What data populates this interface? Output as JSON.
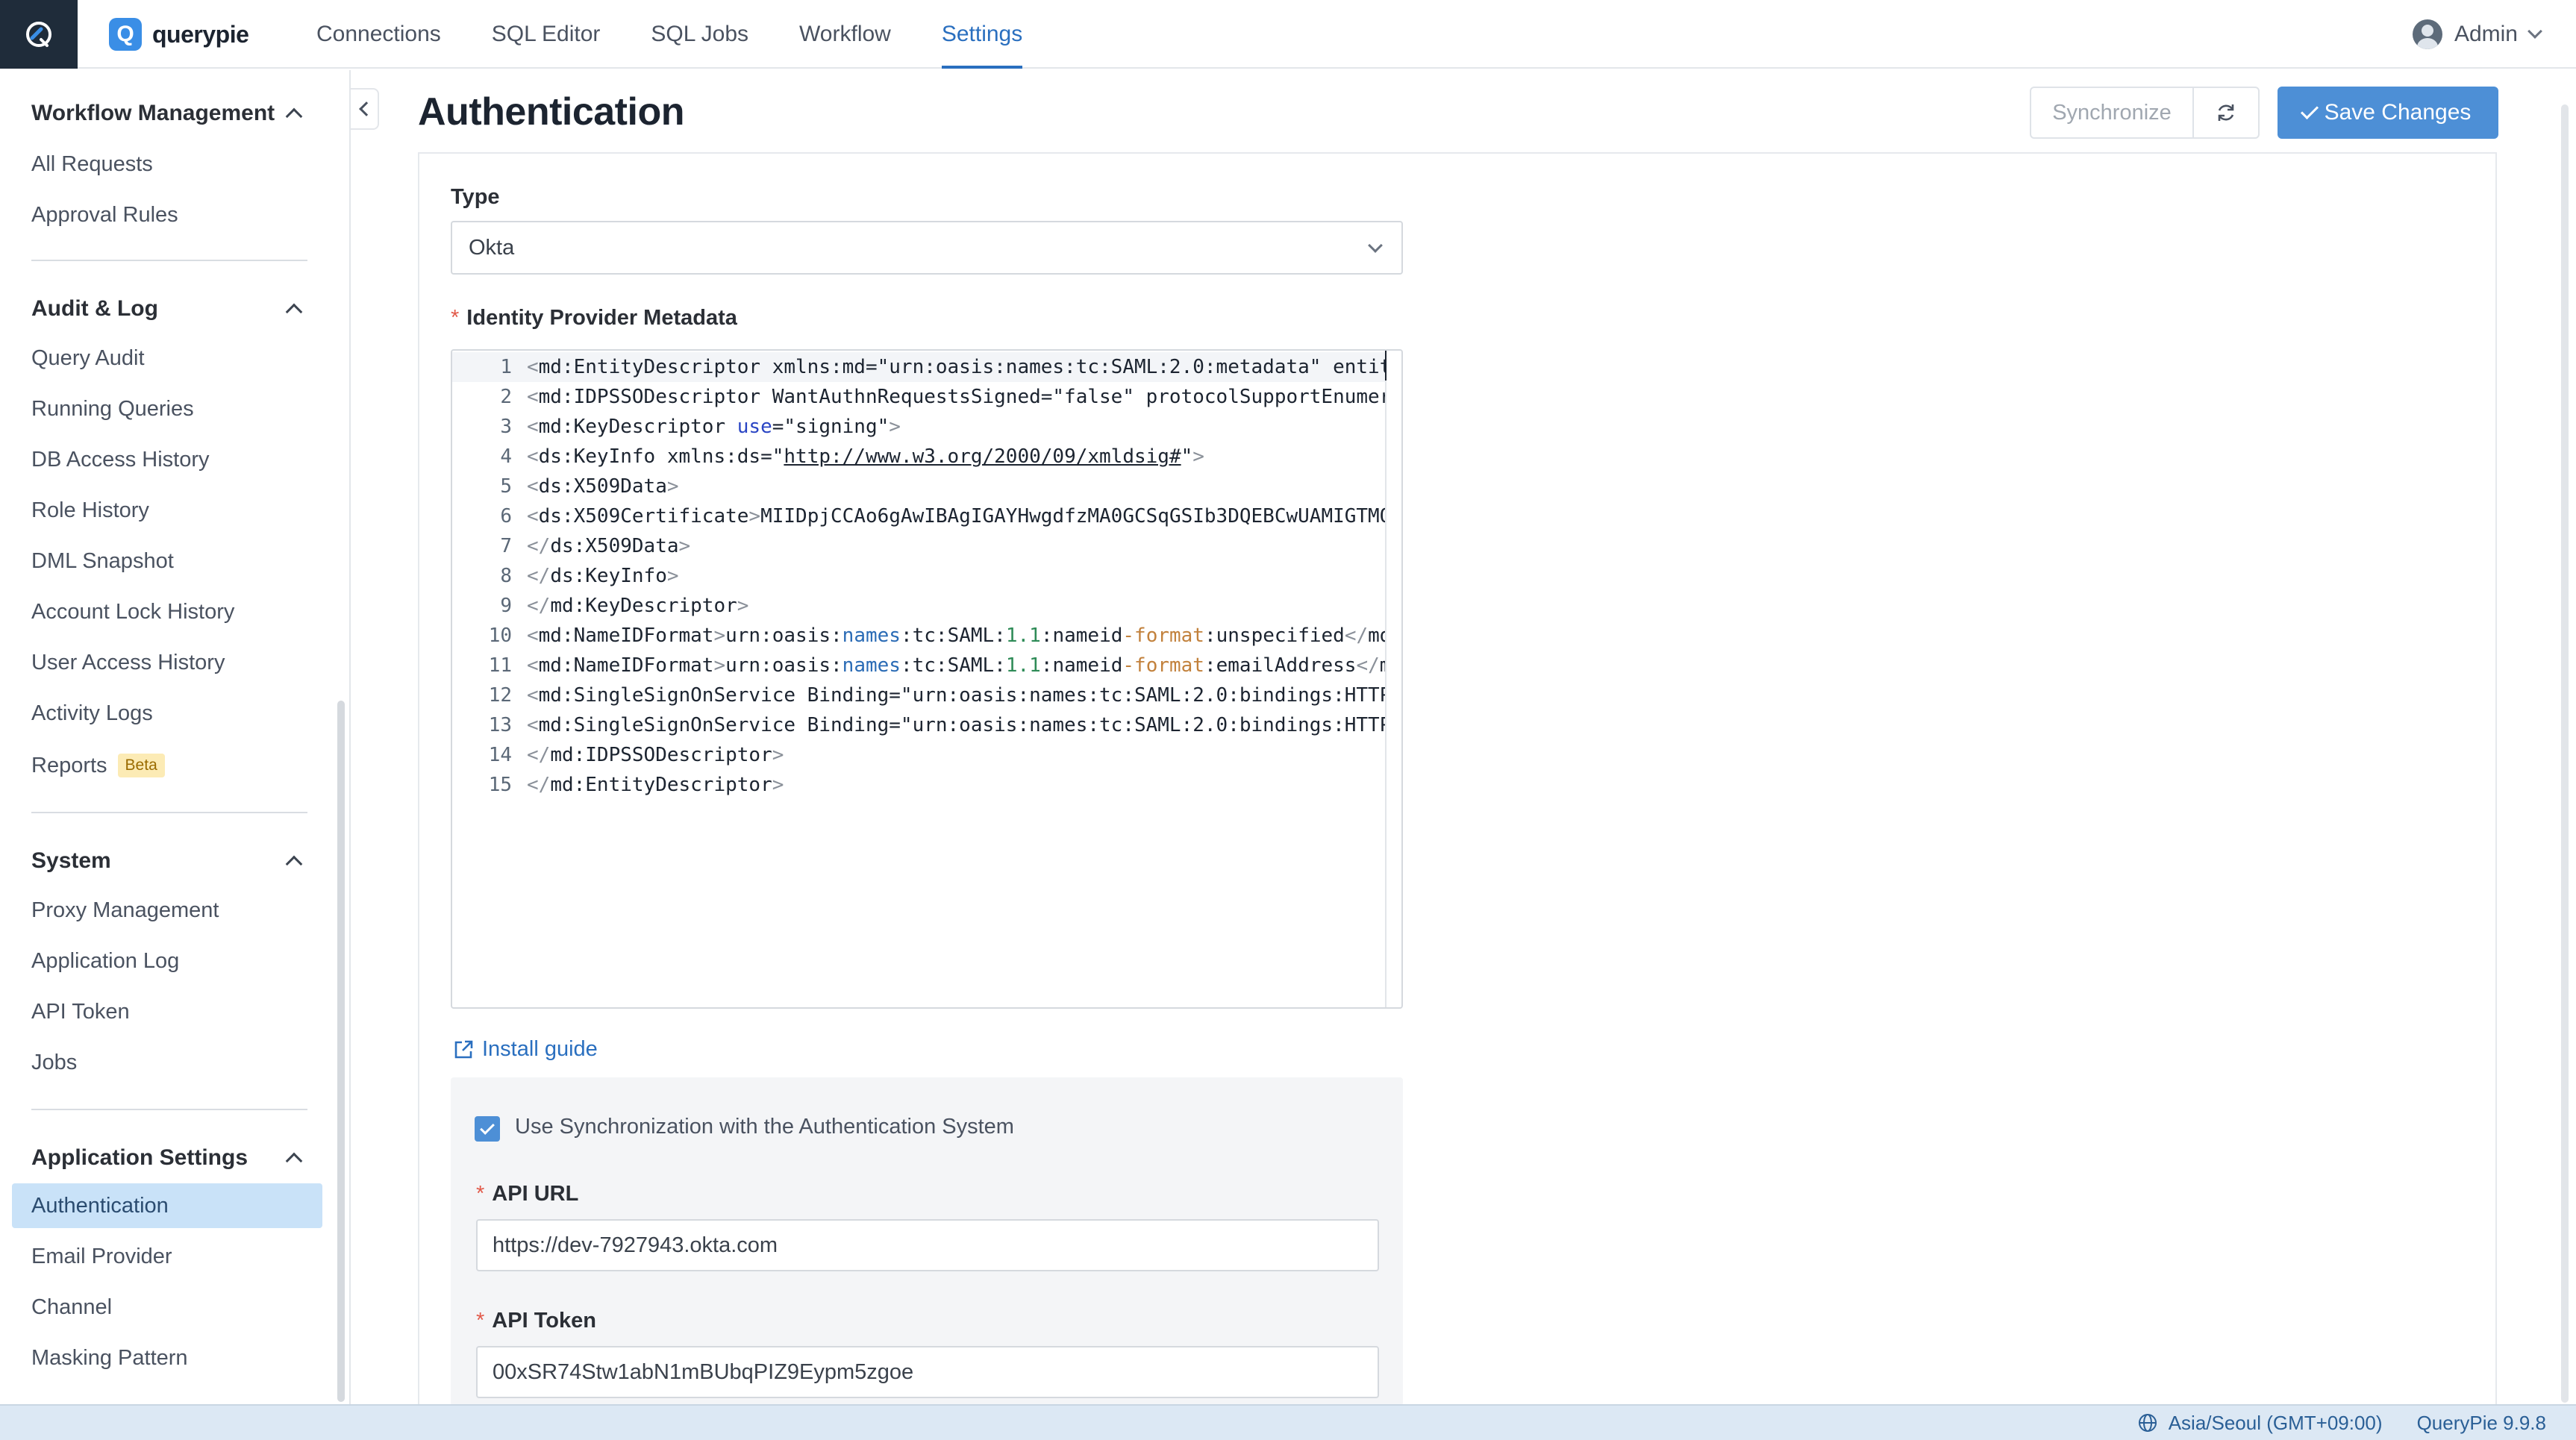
{
  "topbar": {
    "brand": "querypie",
    "nav": [
      "Connections",
      "SQL Editor",
      "SQL Jobs",
      "Workflow",
      "Settings"
    ],
    "active_nav": "Settings",
    "user": "Admin"
  },
  "sidebar": {
    "workflow": {
      "title": "Workflow Management",
      "items": [
        "All Requests",
        "Approval Rules"
      ]
    },
    "audit": {
      "title": "Audit & Log",
      "items": [
        "Query Audit",
        "Running Queries",
        "DB Access History",
        "Role History",
        "DML Snapshot",
        "Account Lock History",
        "User Access History",
        "Activity Logs",
        "Reports"
      ],
      "reports_badge": "Beta"
    },
    "system": {
      "title": "System",
      "items": [
        "Proxy Management",
        "Application Log",
        "API Token",
        "Jobs"
      ]
    },
    "app_settings": {
      "title": "Application Settings",
      "items": [
        "Authentication",
        "Email Provider",
        "Channel",
        "Masking Pattern"
      ],
      "active": "Authentication"
    }
  },
  "page": {
    "title": "Authentication",
    "synchronize_label": "Synchronize",
    "save_label": "Save Changes"
  },
  "form": {
    "type_label": "Type",
    "type_value": "Okta",
    "metadata_label": "Identity Provider Metadata",
    "install_guide": "Install guide",
    "sync_checkbox_label": "Use Synchronization with the Authentication System",
    "sync_checked": true,
    "api_url_label": "API URL",
    "api_url_value": "https://dev-7927943.okta.com",
    "api_token_label": "API Token",
    "api_token_value": "00xSR74Stw1abN1mBUbqPIZ9Eypm5zgoe"
  },
  "editor": {
    "line_numbers": [
      "1",
      "2",
      "3",
      "4",
      "5",
      "6",
      "7",
      "8",
      "9",
      "10",
      "11",
      "12",
      "13",
      "14",
      "15"
    ],
    "lines": [
      "<md:EntityDescriptor xmlns:md=\"urn:oasis:names:tc:SAML:2.0:metadata\" entit",
      "<md:IDPSSODescriptor WantAuthnRequestsSigned=\"false\" protocolSupportEnumer",
      "<md:KeyDescriptor use=\"signing\">",
      "<ds:KeyInfo xmlns:ds=\"http://www.w3.org/2000/09/xmldsig#\">",
      "<ds:X509Data>",
      "<ds:X509Certificate>MIIDpjCCAo6gAwIBAgIGAYHwgdfzMA0GCSqGSIb3DQEBCwUAMIGTMQ",
      "</ds:X509Data>",
      "</ds:KeyInfo>",
      "</md:KeyDescriptor>",
      "<md:NameIDFormat>urn:oasis:names:tc:SAML:1.1:nameid-format:unspecified</md",
      "<md:NameIDFormat>urn:oasis:names:tc:SAML:1.1:nameid-format:emailAddress</m",
      "<md:SingleSignOnService Binding=\"urn:oasis:names:tc:SAML:2.0:bindings:HTTP",
      "<md:SingleSignOnService Binding=\"urn:oasis:names:tc:SAML:2.0:bindings:HTTP",
      "</md:IDPSSODescriptor>",
      "</md:EntityDescriptor>"
    ]
  },
  "statusbar": {
    "timezone": "Asia/Seoul (GMT+09:00)",
    "version": "QueryPie 9.9.8"
  },
  "colors": {
    "accent": "#4d8fd6",
    "active_nav": "#2a6fbf",
    "sidebar_active_bg": "#c9e2f8",
    "brand_dark": "#1f2c3a"
  }
}
